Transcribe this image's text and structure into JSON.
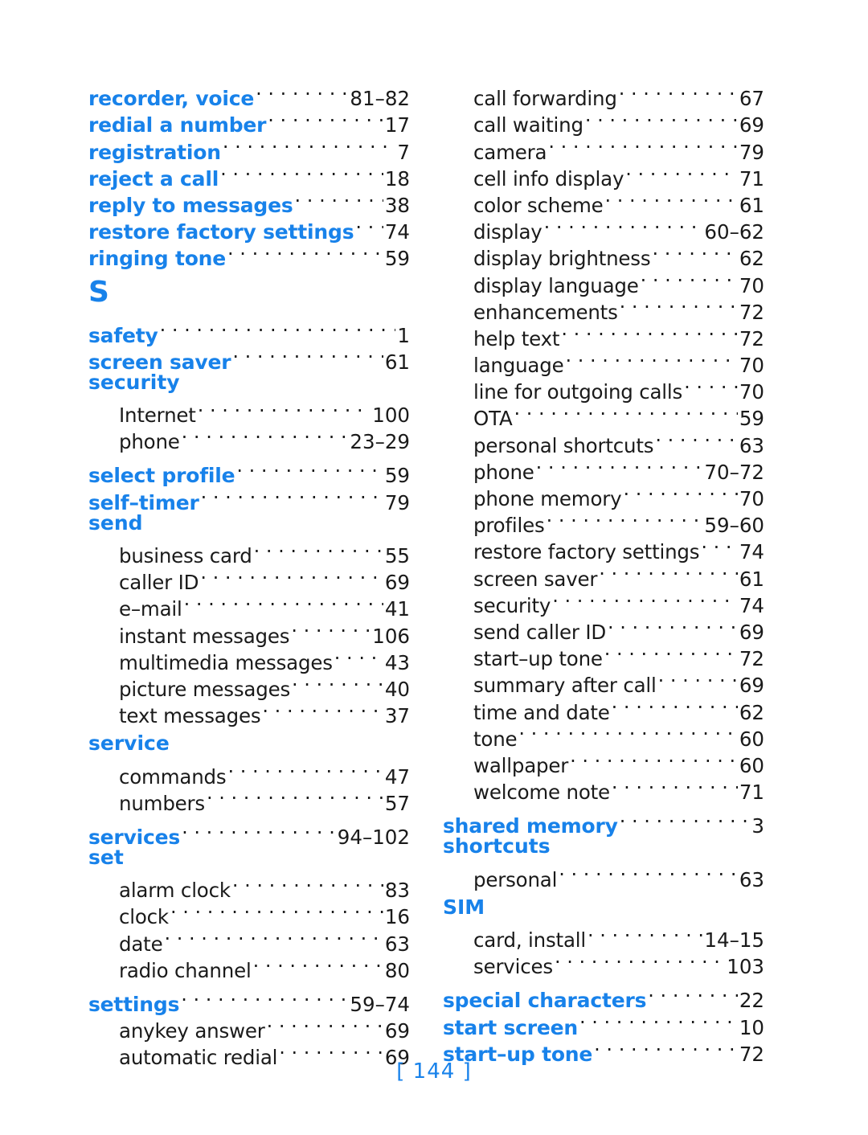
{
  "page": {
    "footer_label": "[ 144 ]",
    "accent_color": "#1882ea",
    "text_color": "#1a1a1a",
    "background_color": "#ffffff"
  },
  "left_column": {
    "blocks": [
      {
        "kind": "entry",
        "level": "top",
        "label": "recorder, voice",
        "page": "81–82"
      },
      {
        "kind": "entry",
        "level": "top",
        "label": "redial a number",
        "page": "17"
      },
      {
        "kind": "entry",
        "level": "top",
        "label": "registration",
        "page": "7"
      },
      {
        "kind": "entry",
        "level": "top",
        "label": "reject a call",
        "page": "18"
      },
      {
        "kind": "entry",
        "level": "top",
        "label": "reply to messages",
        "page": "38"
      },
      {
        "kind": "entry",
        "level": "top",
        "label": "restore factory settings",
        "page": "74"
      },
      {
        "kind": "entry",
        "level": "top",
        "label": "ringing tone",
        "page": "59"
      },
      {
        "kind": "letter",
        "label": "S"
      },
      {
        "kind": "entry",
        "level": "top",
        "label": "safety",
        "page": "1"
      },
      {
        "kind": "entry",
        "level": "top",
        "label": "screen saver",
        "page": "61"
      },
      {
        "kind": "group",
        "label": "security"
      },
      {
        "kind": "entry",
        "level": "sub",
        "label": "Internet",
        "page": "100"
      },
      {
        "kind": "entry",
        "level": "sub",
        "label": "phone",
        "page": "23–29"
      },
      {
        "kind": "gap"
      },
      {
        "kind": "entry",
        "level": "top",
        "label": "select profile",
        "page": "59"
      },
      {
        "kind": "entry",
        "level": "top",
        "label": "self–timer",
        "page": "79"
      },
      {
        "kind": "group",
        "label": "send"
      },
      {
        "kind": "entry",
        "level": "sub",
        "label": "business card",
        "page": "55"
      },
      {
        "kind": "entry",
        "level": "sub",
        "label": "caller ID",
        "page": "69"
      },
      {
        "kind": "entry",
        "level": "sub",
        "label": "e–mail",
        "page": "41"
      },
      {
        "kind": "entry",
        "level": "sub",
        "label": "instant messages",
        "page": "106"
      },
      {
        "kind": "entry",
        "level": "sub",
        "label": "multimedia messages",
        "page": "43"
      },
      {
        "kind": "entry",
        "level": "sub",
        "label": "picture messages",
        "page": "40"
      },
      {
        "kind": "entry",
        "level": "sub",
        "label": "text messages",
        "page": "37"
      },
      {
        "kind": "gap"
      },
      {
        "kind": "group",
        "label": "service"
      },
      {
        "kind": "entry",
        "level": "sub",
        "label": "commands",
        "page": "47"
      },
      {
        "kind": "entry",
        "level": "sub",
        "label": "numbers",
        "page": "57"
      },
      {
        "kind": "gap"
      },
      {
        "kind": "entry",
        "level": "top",
        "label": "services",
        "page": "94–102"
      },
      {
        "kind": "group",
        "label": "set"
      },
      {
        "kind": "entry",
        "level": "sub",
        "label": "alarm clock",
        "page": "83"
      },
      {
        "kind": "entry",
        "level": "sub",
        "label": "clock",
        "page": "16"
      },
      {
        "kind": "entry",
        "level": "sub",
        "label": "date",
        "page": "63"
      },
      {
        "kind": "entry",
        "level": "sub",
        "label": "radio channel",
        "page": "80"
      },
      {
        "kind": "gap"
      },
      {
        "kind": "entry",
        "level": "top",
        "label": "settings",
        "page": "59–74"
      },
      {
        "kind": "entry",
        "level": "sub",
        "label": "anykey answer",
        "page": "69"
      },
      {
        "kind": "entry",
        "level": "sub",
        "label": "automatic redial",
        "page": "69"
      }
    ]
  },
  "right_column": {
    "blocks": [
      {
        "kind": "entry",
        "level": "sub",
        "label": "call forwarding",
        "page": "67"
      },
      {
        "kind": "entry",
        "level": "sub",
        "label": "call waiting",
        "page": "69"
      },
      {
        "kind": "entry",
        "level": "sub",
        "label": "camera",
        "page": "79"
      },
      {
        "kind": "entry",
        "level": "sub",
        "label": "cell info display",
        "page": "71"
      },
      {
        "kind": "entry",
        "level": "sub",
        "label": "color scheme",
        "page": "61"
      },
      {
        "kind": "entry",
        "level": "sub",
        "label": "display",
        "page": "60–62"
      },
      {
        "kind": "entry",
        "level": "sub",
        "label": "display brightness",
        "page": "62"
      },
      {
        "kind": "entry",
        "level": "sub",
        "label": "display language",
        "page": "70"
      },
      {
        "kind": "entry",
        "level": "sub",
        "label": "enhancements",
        "page": "72"
      },
      {
        "kind": "entry",
        "level": "sub",
        "label": "help text",
        "page": "72"
      },
      {
        "kind": "entry",
        "level": "sub",
        "label": "language",
        "page": "70"
      },
      {
        "kind": "entry",
        "level": "sub",
        "label": "line for outgoing calls",
        "page": "70"
      },
      {
        "kind": "entry",
        "level": "sub",
        "label": "OTA",
        "page": "59"
      },
      {
        "kind": "entry",
        "level": "sub",
        "label": "personal shortcuts",
        "page": "63"
      },
      {
        "kind": "entry",
        "level": "sub",
        "label": "phone",
        "page": "70–72"
      },
      {
        "kind": "entry",
        "level": "sub",
        "label": "phone memory",
        "page": "70"
      },
      {
        "kind": "entry",
        "level": "sub",
        "label": "profiles",
        "page": "59–60"
      },
      {
        "kind": "entry",
        "level": "sub",
        "label": "restore factory settings",
        "page": "74"
      },
      {
        "kind": "entry",
        "level": "sub",
        "label": "screen saver",
        "page": "61"
      },
      {
        "kind": "entry",
        "level": "sub",
        "label": "security",
        "page": "74"
      },
      {
        "kind": "entry",
        "level": "sub",
        "label": "send caller ID",
        "page": "69"
      },
      {
        "kind": "entry",
        "level": "sub",
        "label": "start–up tone",
        "page": "72"
      },
      {
        "kind": "entry",
        "level": "sub",
        "label": "summary after call",
        "page": "69"
      },
      {
        "kind": "entry",
        "level": "sub",
        "label": "time and date",
        "page": "62"
      },
      {
        "kind": "entry",
        "level": "sub",
        "label": "tone",
        "page": "60"
      },
      {
        "kind": "entry",
        "level": "sub",
        "label": "wallpaper",
        "page": "60"
      },
      {
        "kind": "entry",
        "level": "sub",
        "label": "welcome note",
        "page": "71"
      },
      {
        "kind": "gap"
      },
      {
        "kind": "entry",
        "level": "top",
        "label": "shared memory",
        "page": "3"
      },
      {
        "kind": "group",
        "label": "shortcuts"
      },
      {
        "kind": "entry",
        "level": "sub",
        "label": "personal",
        "page": "63"
      },
      {
        "kind": "gap"
      },
      {
        "kind": "group",
        "label": "SIM"
      },
      {
        "kind": "entry",
        "level": "sub",
        "label": "card, install",
        "page": "14–15"
      },
      {
        "kind": "entry",
        "level": "sub",
        "label": "services",
        "page": "103"
      },
      {
        "kind": "gap"
      },
      {
        "kind": "entry",
        "level": "top",
        "label": "special characters",
        "page": "22"
      },
      {
        "kind": "entry",
        "level": "top",
        "label": "start screen",
        "page": "10"
      },
      {
        "kind": "entry",
        "level": "top",
        "label": "start–up tone",
        "page": "72"
      }
    ]
  }
}
